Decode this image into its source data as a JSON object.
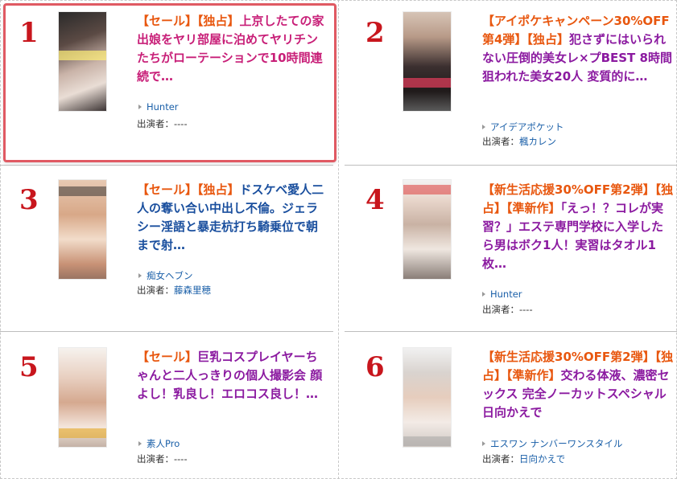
{
  "items": [
    {
      "rank": "1",
      "title_tags": "【セール】【独占】",
      "title_text": "上京したての家出娘をヤリ部屋に泊めてヤリチンたちがローテーションで10時間連続で…",
      "maker": "Hunter",
      "actor_label": "出演者：",
      "actor": "----"
    },
    {
      "rank": "2",
      "title_tags": "【アイポケキャンペーン30%OFF第4弾】【独占】",
      "title_text": "犯さずにはいられない圧倒的美女レ×プBEST 8時間 狙われた美女20人 変質的に…",
      "maker": "アイデアポケット",
      "actor_label": "出演者：",
      "actor": "楓カレン"
    },
    {
      "rank": "3",
      "title_tags": "【セール】【独占】",
      "title_text": "ドスケベ愛人二人の奪い合い中出し不倫。ジェラシー淫語と暴走杭打ち騎乗位で朝まで射…",
      "maker": "痴女ヘブン",
      "actor_label": "出演者：",
      "actor": "藤森里穂"
    },
    {
      "rank": "4",
      "title_tags": "【新生活応援30%OFF第2弾】【独占】【準新作】",
      "title_text": "「えっ！？コレが実習？」エステ専門学校に入学したら男はボク1人！実習はタオル1枚…",
      "maker": "Hunter",
      "actor_label": "出演者：",
      "actor": "----"
    },
    {
      "rank": "5",
      "title_tags": "【セール】",
      "title_text": "巨乳コスプレイヤーちゃんと二人っきりの個人撮影会 顔よし！乳良し！エロコス良し！…",
      "maker": "素人Pro",
      "actor_label": "出演者：",
      "actor": "----"
    },
    {
      "rank": "6",
      "title_tags": "【新生活応援30%OFF第2弾】【独占】【準新作】",
      "title_text": "交わる体液、濃密セックス 完全ノーカットスペシャル 日向かえで",
      "maker": "エスワン ナンバーワンスタイル",
      "actor_label": "出演者：",
      "actor": "日向かえで"
    }
  ],
  "colors": {
    "rank": "#c8161d",
    "tag": "#e8570f",
    "title_blue": "#1a4f9e",
    "title_purple": "#8b1aa0",
    "link": "#1a5fa8",
    "highlight_border": "#e05a63"
  }
}
